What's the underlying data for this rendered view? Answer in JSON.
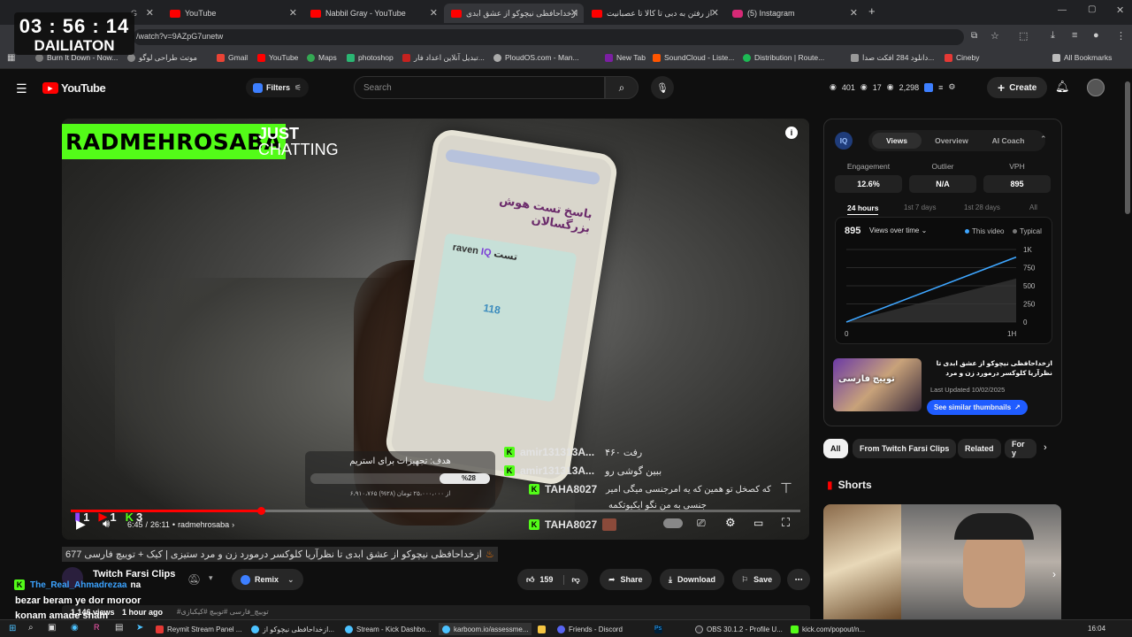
{
  "browser": {
    "tabs": [
      {
        "label": "YouTube",
        "color": "#ff0000"
      },
      {
        "label": "Nabbil Gray - YouTube",
        "color": "#ff0000"
      },
      {
        "label": "ازخداحافظی نیچوکو از عشق ابدی",
        "color": "#ff0000"
      },
      {
        "label": "از رفتن به دبی تا کالا تا عصبانیت",
        "color": "#ff0000"
      },
      {
        "label": "(5) Instagram",
        "color": "#d62976"
      }
    ],
    "url": "/watch?v=9AZpG7unetw",
    "bookmarks": [
      "Burn It Down - Now...",
      "موتث طراحی لوگو",
      "Gmail",
      "YouTube",
      "Maps",
      "photoshop",
      "تبدیل آنلاین اعداد فار...",
      "PloudOS.com - Man...",
      "New Tab",
      "SoundCloud - Liste...",
      "Distribution | Route...",
      "دانلود 284 افکت صدا...",
      "Cineby",
      "All Bookmarks"
    ]
  },
  "overlay_timer": {
    "time": "03 : 56 : 14",
    "label": "DAILIATON"
  },
  "youtube": {
    "logo": "YouTube",
    "filters_label": "Filters",
    "search_placeholder": "Search",
    "header_stats": {
      "a": "401",
      "b": "17",
      "c": "2,298"
    },
    "create_label": "Create"
  },
  "video": {
    "streamer_name": "RADMEHROSABA",
    "category_line1": "JUST",
    "category_line2": "CHATTING",
    "goal_title": "هدف: تجهیزات برای استریم",
    "goal_percent": "%28",
    "goal_amount": "۶،۹۱۰،۷۶۵ از ۲۵،۰۰۰،۰۰۰ تومان (۲۸%)",
    "goal_progress": 0.28,
    "chat": [
      {
        "user": "amir131313A...",
        "msg": "رفت ۴۶۰",
        "color": "#ffffff"
      },
      {
        "user": "amir131313A...",
        "msg": "ببین گوشی رو",
        "color": "#ffffff"
      },
      {
        "user": "TAHA8027",
        "msg": "که کصخل تو همین که یه امرجنسی میگی امیر",
        "color": "#ffffff"
      },
      {
        "user": "",
        "msg": "جنسی به من نگو ایکیوتکمه",
        "color": "#ffffff"
      },
      {
        "user": "TAHA8027",
        "msg": "",
        "color": "#ffffff"
      }
    ],
    "overlay_counts": {
      "a": "1",
      "b": "1",
      "c": "3"
    },
    "time_current": "6:45",
    "time_total": "26:11",
    "chapter": "radmehrosaba",
    "progress": 0.26
  },
  "title_text": "ازخداحافظی نیچوکو از عشق ابدی تا نظرآریا کلوکسر درمورد زن و مرد ستیزی | کیک + توییچ فارسی 677",
  "channel": {
    "name": "Twitch Farsi Clips",
    "remix": "Remix"
  },
  "actions": {
    "likes": "159",
    "share": "Share",
    "download": "Download",
    "save": "Save"
  },
  "meta": {
    "views": "1,146 views",
    "age": "1 hour ago",
    "tags": "#توییچ_فارسی #توییچ #کیکبازی"
  },
  "cam_chat": [
    {
      "user": "The_Real_Ahmadrezaa",
      "msg": "na"
    },
    {
      "user": "",
      "msg": "bezar beram ye dor moroor"
    },
    {
      "user": "",
      "msg": "konam amade sham"
    }
  ],
  "iq_panel": {
    "tabs": [
      "Views",
      "Overview",
      "AI Coach"
    ],
    "stats": [
      {
        "label": "Engagement",
        "value": "12.6%"
      },
      {
        "label": "Outlier",
        "value": "N/A"
      },
      {
        "label": "VPH",
        "value": "895"
      }
    ],
    "ranges": [
      "24 hours",
      "1st 7 days",
      "1st 28 days",
      "All"
    ],
    "views_value": "895",
    "views_dropdown": "Views over time",
    "legend": [
      "This video",
      "Typical"
    ],
    "thumb_title": "ازخداحافظی نیچوکو از عشق ابدی تا نظرآریا کلوکسر درمورد زن و مرد ستیزی | کیک +",
    "last_updated": "Last Updated 10/02/2025",
    "similar_button": "See similar thumbnails"
  },
  "chart_data": {
    "type": "line",
    "x": [
      0,
      1
    ],
    "xlabels": [
      "0",
      "1H"
    ],
    "yticks": [
      "1K",
      "750",
      "500",
      "250",
      "0"
    ],
    "ylim": [
      0,
      1000
    ],
    "series": [
      {
        "name": "This video",
        "values": [
          0,
          895
        ]
      },
      {
        "name": "Typical",
        "values": [
          0,
          600
        ]
      }
    ]
  },
  "related": {
    "chips": [
      "All",
      "From Twitch Farsi Clips",
      "Related",
      "For y"
    ],
    "shorts_label": "Shorts"
  },
  "taskbar": [
    "Reymit Stream Panel ...",
    "ازخداحافظی نیچوکو از...",
    "Stream - Kick Dashbo...",
    "karboom.io/assessme...",
    "Friends - Discord",
    "OBS 30.1.2 - Profile U...",
    "kick.com/popout/n..."
  ],
  "taskbar_time": "16:04"
}
